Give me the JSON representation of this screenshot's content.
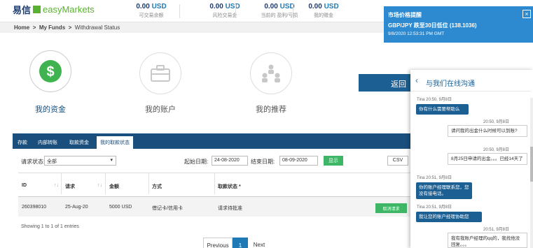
{
  "header": {
    "logo_cn": "易信",
    "logo_en": "easyMarkets",
    "stats": [
      {
        "value": "0.00",
        "currency": "USD",
        "label": "可交易余额"
      },
      {
        "value": "0.00",
        "currency": "USD",
        "label": "风险交易金"
      },
      {
        "value": "0.00",
        "currency": "USD",
        "label": "当前的 盈利/亏损"
      },
      {
        "value": "0.00",
        "currency": "USD",
        "label": "我的赠金"
      }
    ]
  },
  "breadcrumb": {
    "home": "Home",
    "sep1": ">",
    "funds": "My Funds",
    "sep2": ">",
    "current": "Withdrawal Status"
  },
  "nav_circles": [
    {
      "label": "我的资金",
      "icon": "dollar-icon"
    },
    {
      "label": "我的账户",
      "icon": "briefcase-icon"
    },
    {
      "label": "我的推荐",
      "icon": "referral-icon"
    }
  ],
  "back_button": "返回",
  "tabs": [
    "存款",
    "内部转账",
    "取款资金",
    "我的取款状态"
  ],
  "filter": {
    "status_label": "请求状态:",
    "status_value": "全部",
    "start_label": "起始日期:",
    "start_value": "24-08-2020",
    "end_label": "结束日期:",
    "end_value": "08-09-2020",
    "show_button": "显示",
    "csv_button": "CSV"
  },
  "table": {
    "headers": [
      "ID",
      "请求",
      "金额",
      "方式",
      "取款状态 *"
    ],
    "rows": [
      {
        "id": "260398010",
        "date": "25-Aug-20",
        "amount": "5000 USD",
        "method": "借记卡/信用卡",
        "status": "请求待批准",
        "action": "取消请求"
      }
    ]
  },
  "showing": "Showing 1 to 1 of 1 entries",
  "pagination": {
    "previous": "Previous",
    "page": "1",
    "next": "Next"
  },
  "alert": {
    "title": "市场价格提醒",
    "body": "GBP/JPY 跌至30日低位 (138.1036)",
    "time": "9/8/2020 12:53:31 PM GMT",
    "close": "×"
  },
  "chat": {
    "title": "与我们在线沟通",
    "messages": [
      {
        "from": "agent",
        "meta": "Tina 20:50, 9月8日",
        "text": "你有什么需要帮助么"
      },
      {
        "from": "me",
        "meta": "20:50, 9月8日",
        "text": "请问我的出金什么时候可以到账?"
      },
      {
        "from": "me",
        "meta": "20:50, 9月8日",
        "text": "8月25日申请的出金。。。已经14天了"
      },
      {
        "from": "agent",
        "meta": "Tina 20:51, 9月8日",
        "text": "你的账户经理联系您，您没有接电话。"
      },
      {
        "from": "agent",
        "meta": "Tina 20:51, 9月8日",
        "text": "我让您的账户经理协助您"
      },
      {
        "from": "me",
        "meta": "20:51, 9月8日",
        "text": "我有我账户经理的qq的，我找他没回复。。。"
      }
    ]
  },
  "colors": {
    "navy": "#1a4f7d",
    "accent": "#1f79b5",
    "green": "#3db665",
    "alert": "#2e8ad0"
  }
}
